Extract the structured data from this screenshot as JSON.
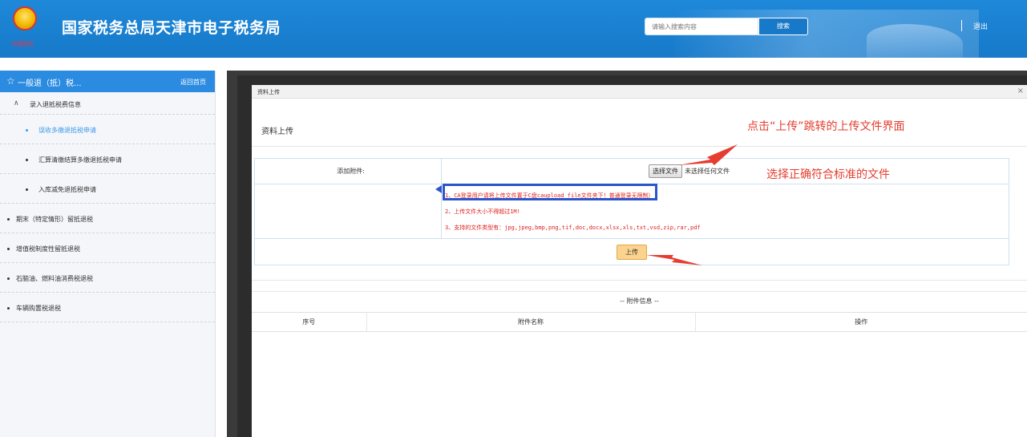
{
  "header": {
    "emblem_text": "中国税务",
    "site_title": "国家税务总局天津市电子税务局",
    "search_placeholder": "请输入搜索内容",
    "search_button": "搜索",
    "logout": "退出"
  },
  "sidebar": {
    "title": "一般退（抵）税...",
    "back_home": "返回首页",
    "group_label": "录入退抵税费信息",
    "items": [
      {
        "label": "误收多缴退抵税申请",
        "level": "sub",
        "active": true
      },
      {
        "label": "汇算清缴结算多缴退抵税申请",
        "level": "sub",
        "active": false
      },
      {
        "label": "入库减免退抵税申请",
        "level": "sub",
        "active": false
      },
      {
        "label": "期末（特定情形）留抵退税",
        "level": "top",
        "active": false
      },
      {
        "label": "增值税制度性留抵退税",
        "level": "top",
        "active": false
      },
      {
        "label": "石脑油、燃料油消费税退税",
        "level": "top",
        "active": false
      },
      {
        "label": "车辆购置税退税",
        "level": "top",
        "active": false
      }
    ]
  },
  "dialog": {
    "bar_title": "资料上传",
    "close": "×",
    "section_title": "资料上传",
    "attach_label": "添加附件:",
    "file_button": "选择文件",
    "file_status": "未选择任何文件",
    "tips": [
      "1、CA登录用户请将上传文件置于C盘caupload file文件夹下！普通登录无限制）",
      "2、上传文件大小不得超过1M!",
      "3、支持的文件类型有：jpg,jpeg,bmp,png,tif,doc,docx,xlsx,xls,txt,vsd,zip,rar,pdf"
    ],
    "upload_button": "上传",
    "attach_info_title": "-- 附件信息 --",
    "attach_columns": [
      "序号",
      "附件名称",
      "操作"
    ]
  },
  "annotations": {
    "note_upload": "点击“上传”跳转的上传文件界面",
    "note_select": "选择正确符合标准的文件",
    "color": "#e53d2f",
    "highlight_color": "#2b55c9"
  }
}
